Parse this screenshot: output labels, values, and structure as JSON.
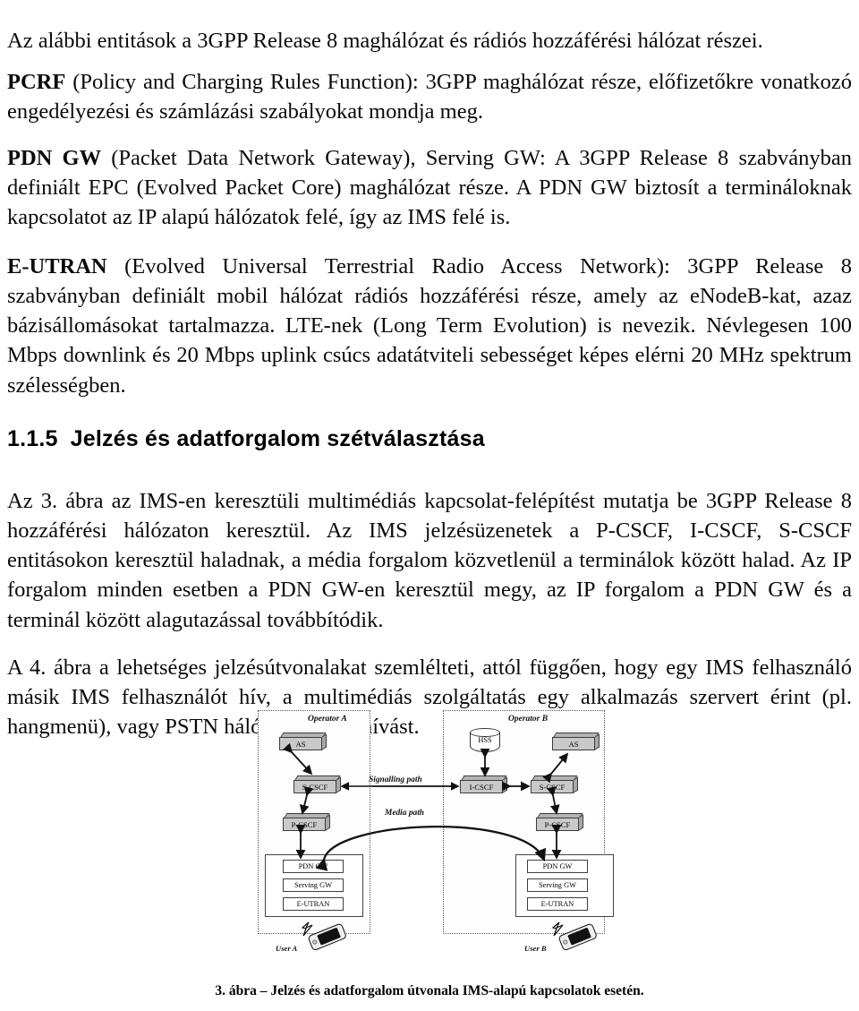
{
  "document": {
    "language": "hu",
    "paragraphs": {
      "intro": "Az alábbi entitások a 3GPP Release 8 maghálózat és rádiós hozzáférési hálózat részei.",
      "pcrf_term": "PCRF",
      "pcrf_body": " (Policy and Charging Rules Function): 3GPP maghálózat része, előfizetőkre vonatkozó engedélyezési és számlázási szabályokat mondja meg.",
      "pdngw_term": "PDN GW",
      "pdngw_body": " (Packet Data Network Gateway), Serving GW: A 3GPP Release 8 szabványban definiált EPC (Evolved Packet Core) maghálózat része. A PDN GW biztosít a termináloknak kapcsolatot az IP alapú hálózatok felé, így az IMS felé is.",
      "eutran_term": "E-UTRAN",
      "eutran_body": " (Evolved Universal Terrestrial Radio Access Network): 3GPP Release 8 szabványban definiált mobil hálózat rádiós hozzáférési része, amely az eNodeB-kat, azaz bázisállomásokat tartalmazza. LTE-nek (Long Term Evolution) is nevezik. Névlegesen 100 Mbps downlink és 20 Mbps uplink csúcs adatátviteli sebességet képes elérni 20 MHz spektrum szélességben.",
      "section_para_1": "Az 3. ábra az IMS-en keresztüli multimédiás kapcsolat-felépítést mutatja be 3GPP Release 8 hozzáférési hálózaton keresztül. Az IMS jelzésüzenetek a P-CSCF, I-CSCF, S-CSCF entitásokon keresztül haladnak, a média forgalom közvetlenül a terminálok között halad. Az IP forgalom minden esetben a PDN GW-en keresztül megy, az IP forgalom a PDN GW és a terminál között alagutazással továbbítódik.",
      "section_para_2": "A 4. ábra a lehetséges jelzésútvonalakat szemlélteti, attól függően, hogy egy IMS felhasználó másik IMS felhasználót hív, a multimédiás szolgáltatás egy alkalmazás szervert érint (pl. hangmenü), vagy PSTN hálózatba intéz hívást."
    },
    "heading": {
      "number": "1.1.5",
      "title": "Jelzés és adatforgalom szétválasztása"
    },
    "figure": {
      "caption": "3. ábra – Jelzés és adatforgalom útvonala IMS-alapú kapcsolatok esetén.",
      "operator_a_label": "Operator A",
      "operator_b_label": "Operator B",
      "signalling_path_label": "Signalling  path",
      "media_path_label": "Media path",
      "user_a_label": "User A",
      "user_b_label": "User B",
      "nodes": {
        "as_a": "AS",
        "s_cscf_a": "S-CSCF",
        "p_cscf_a": "P-CSCF",
        "hss": "HSS",
        "i_cscf": "I-CSCF",
        "s_cscf_b": "S-CSCF",
        "as_b": "AS",
        "p_cscf_b": "P-CSCF",
        "pdn_gw_a": "PDN GW",
        "serving_gw_a": "Serving GW",
        "eutran_a": "E-UTRAN",
        "pdn_gw_b": "PDN GW",
        "serving_gw_b": "Serving GW",
        "eutran_b": "E-UTRAN"
      }
    }
  }
}
